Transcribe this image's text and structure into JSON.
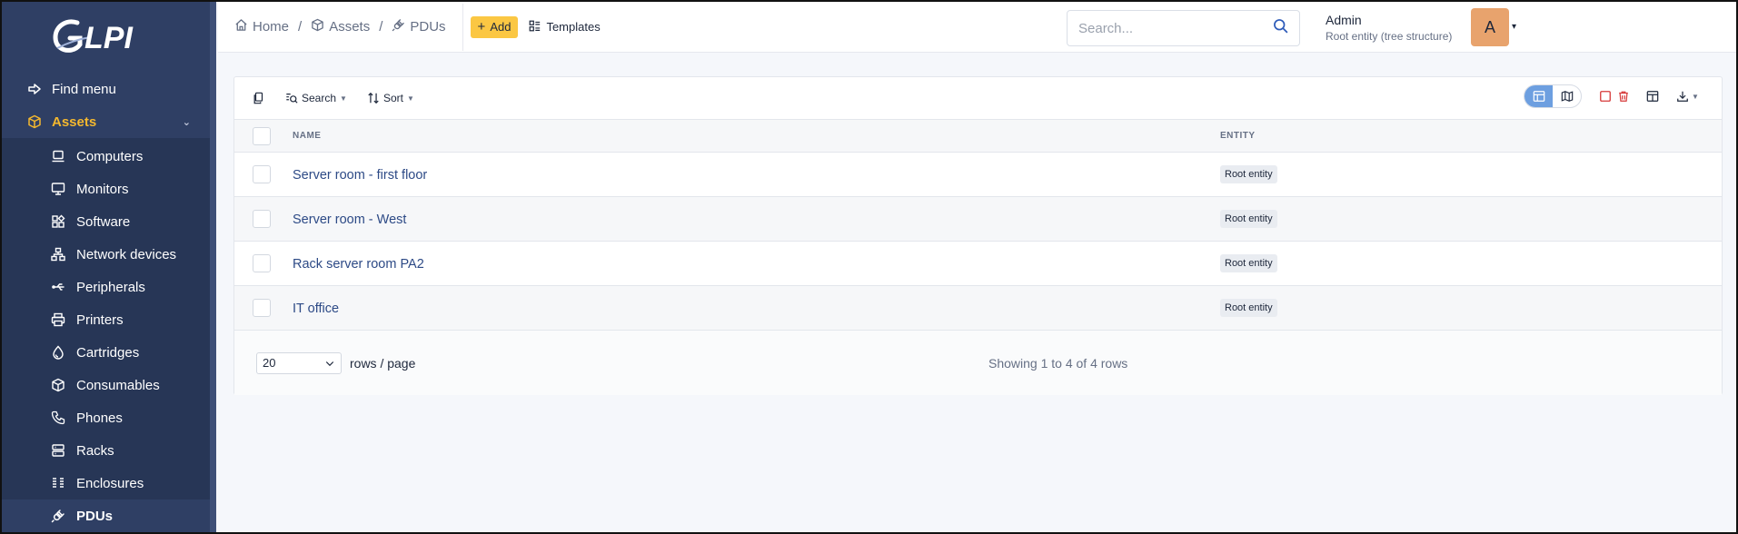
{
  "logo": {
    "text": "GLPI"
  },
  "sidebar": {
    "find_menu": "Find menu",
    "section_assets": "Assets",
    "items": [
      {
        "label": "Computers",
        "icon": "computer-icon"
      },
      {
        "label": "Monitors",
        "icon": "monitor-icon"
      },
      {
        "label": "Software",
        "icon": "software-icon"
      },
      {
        "label": "Network devices",
        "icon": "network-icon"
      },
      {
        "label": "Peripherals",
        "icon": "usb-icon"
      },
      {
        "label": "Printers",
        "icon": "printer-icon"
      },
      {
        "label": "Cartridges",
        "icon": "droplet-icon"
      },
      {
        "label": "Consumables",
        "icon": "package-icon"
      },
      {
        "label": "Phones",
        "icon": "phone-icon"
      },
      {
        "label": "Racks",
        "icon": "server-icon"
      },
      {
        "label": "Enclosures",
        "icon": "columns-icon"
      },
      {
        "label": "PDUs",
        "icon": "plug-icon",
        "active": true
      }
    ]
  },
  "header": {
    "breadcrumb": [
      "Home",
      "Assets",
      "PDUs"
    ],
    "add_label": "Add",
    "templates_label": "Templates",
    "search_placeholder": "Search...",
    "user_name": "Admin",
    "user_entity": "Root entity (tree structure)",
    "avatar_initial": "A"
  },
  "toolbar": {
    "search_label": "Search",
    "sort_label": "Sort"
  },
  "table": {
    "columns": [
      "NAME",
      "ENTITY"
    ],
    "rows": [
      {
        "name": "Server room - first floor",
        "entity": "Root entity"
      },
      {
        "name": "Server room - West",
        "entity": "Root entity"
      },
      {
        "name": "Rack server room PA2",
        "entity": "Root entity"
      },
      {
        "name": "IT office",
        "entity": "Root entity"
      }
    ]
  },
  "pager": {
    "page_size": "20",
    "rows_per_page_label": "rows / page",
    "showing_text": "Showing 1 to 4 of 4 rows"
  },
  "colors": {
    "sidebar_bg": "#2f3f64",
    "accent": "#f5b82e",
    "add_button": "#fbc743",
    "avatar": "#e8a36d",
    "link": "#2d4a86"
  }
}
